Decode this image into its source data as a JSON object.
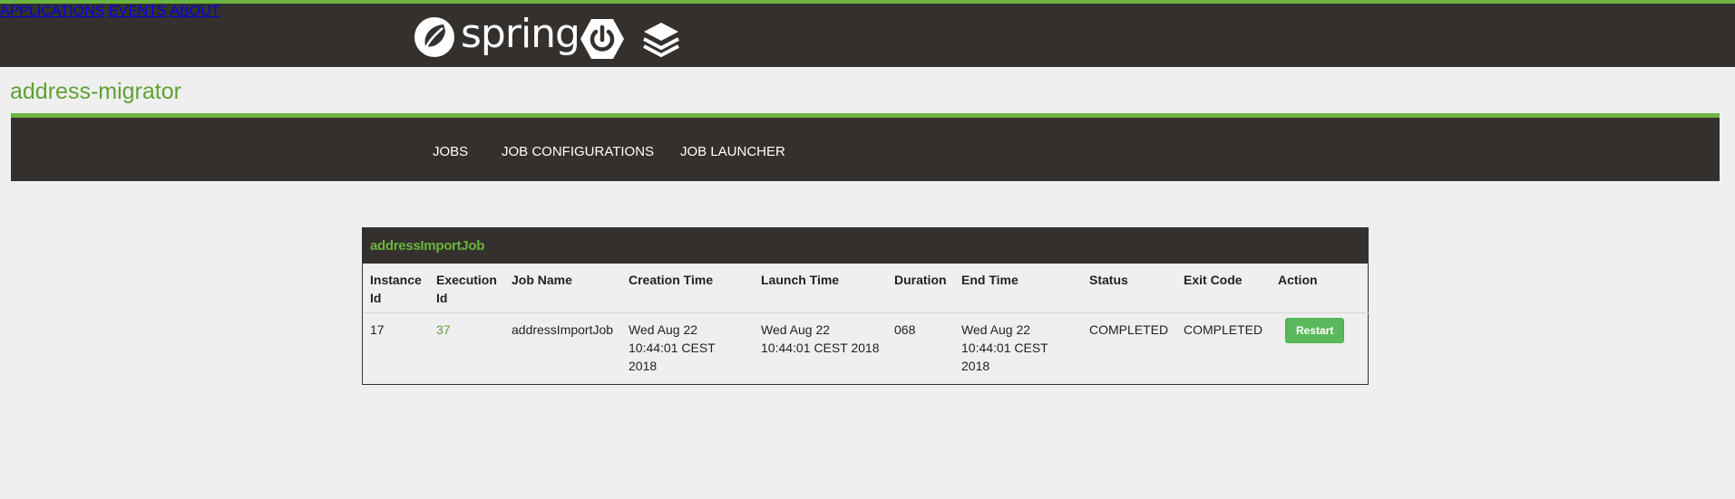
{
  "brand": {
    "logo_text": "spring",
    "icons": [
      "spring-leaf-icon",
      "spring-boot-power-icon",
      "stack-layers-icon"
    ],
    "accent_color": "#6db33f",
    "bar_color": "#34302d"
  },
  "topnav": {
    "applications": "APPLICATIONS",
    "events": "EVENTS",
    "about": "ABOUT"
  },
  "app": {
    "title": "address-migrator"
  },
  "subnav": {
    "jobs": "JOBS",
    "job_configurations": "JOB CONFIGURATIONS",
    "job_launcher": "JOB LAUNCHER"
  },
  "panel": {
    "title": "addressImportJob",
    "columns": [
      "Instance Id",
      "Execution Id",
      "Job Name",
      "Creation Time",
      "Launch Time",
      "Duration",
      "End Time",
      "Status",
      "Exit Code",
      "Action"
    ],
    "rows": [
      {
        "instance_id": "17",
        "execution_id": "37",
        "job_name": "addressImportJob",
        "creation_time": "Wed Aug 22 10:44:01 CEST 2018",
        "launch_time": "Wed Aug 22 10:44:01 CEST 2018",
        "duration": "068",
        "end_time": "Wed Aug 22 10:44:01 CEST 2018",
        "status": "COMPLETED",
        "exit_code": "COMPLETED",
        "action_label": "Restart"
      }
    ]
  }
}
